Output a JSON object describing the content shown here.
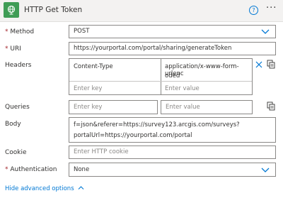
{
  "action": {
    "title": "HTTP Get Token",
    "help_label": "?",
    "more_label": "···"
  },
  "fields": {
    "method": {
      "label": "Method",
      "required_mark": "*",
      "value": "POST"
    },
    "uri": {
      "label": "URI",
      "required_mark": "*",
      "value": "https://yourportal.com/portal/sharing/generateToken"
    },
    "headers": {
      "label": "Headers",
      "rows": [
        {
          "key": "Content-Type",
          "value_line1": "application/x-www-form-urlenc",
          "value_line2": "oded"
        }
      ],
      "key_placeholder": "Enter key",
      "value_placeholder": "Enter value"
    },
    "queries": {
      "label": "Queries",
      "key_placeholder": "Enter key",
      "value_placeholder": "Enter value"
    },
    "body": {
      "label": "Body",
      "line1": "f=json&referer=https://survey123.arcgis.com/surveys?",
      "line2": "portalUrl=https://yourportal.com/portal"
    },
    "cookie": {
      "label": "Cookie",
      "placeholder": "Enter HTTP cookie"
    },
    "authentication": {
      "label": "Authentication",
      "required_mark": "*",
      "value": "None"
    }
  },
  "advanced_toggle": "Hide advanced options"
}
